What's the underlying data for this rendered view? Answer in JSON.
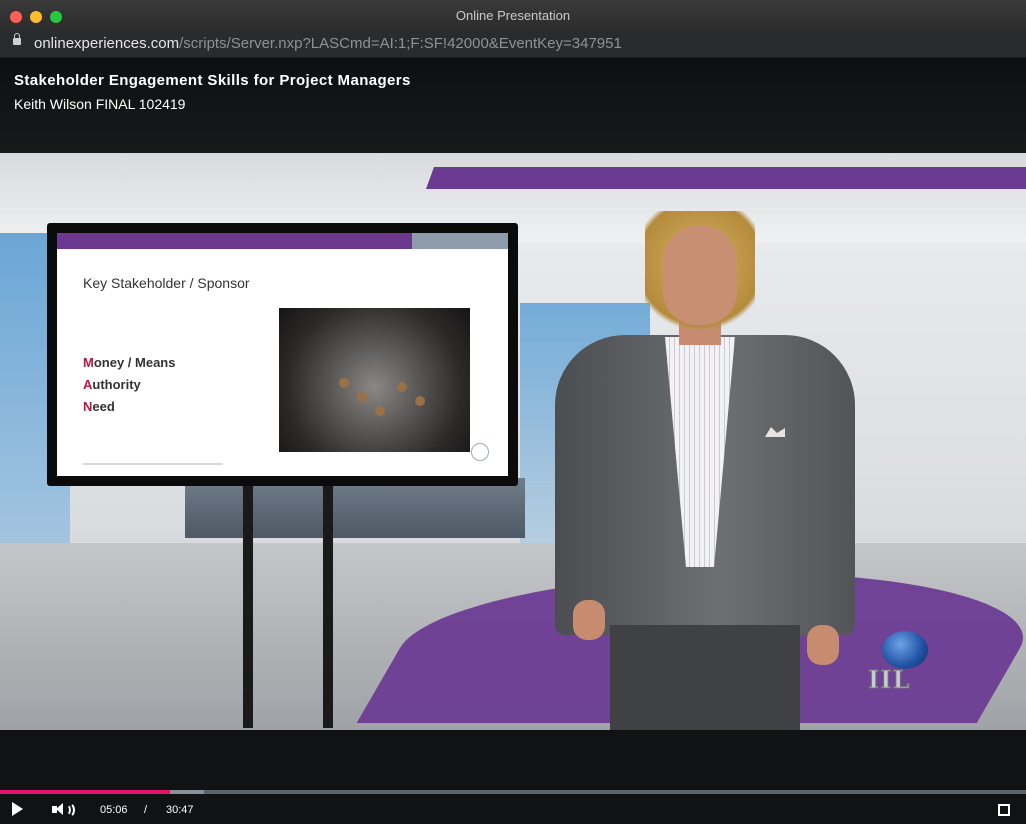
{
  "window": {
    "title": "Online Presentation"
  },
  "address_bar": {
    "host": "onlinexperiences.com",
    "path": "/scripts/Server.nxp?LASCmd=AI:1;F:SF!42000&EventKey=347951"
  },
  "course": {
    "title": "Stakeholder Engagement Skills for Project Managers",
    "subtitle": "Keith Wilson FINAL 102419"
  },
  "slide": {
    "title": "Key Stakeholder / Sponsor",
    "items": [
      {
        "accent": "M",
        "rest": "oney / Means"
      },
      {
        "accent": "A",
        "rest": "uthority"
      },
      {
        "accent": "N",
        "rest": "eed"
      }
    ],
    "accent_color": "#c0143c",
    "bar_color": "#6b3a90"
  },
  "video_logo": {
    "text": "IIL"
  },
  "player": {
    "current_time": "05:06",
    "separator": "/",
    "duration": "30:47",
    "progress_fraction": 0.166,
    "buffered_fraction": 0.199,
    "progress_color": "#e2136a"
  },
  "icons": [
    "lock-icon",
    "play-icon",
    "volume-icon",
    "fullscreen-icon"
  ]
}
